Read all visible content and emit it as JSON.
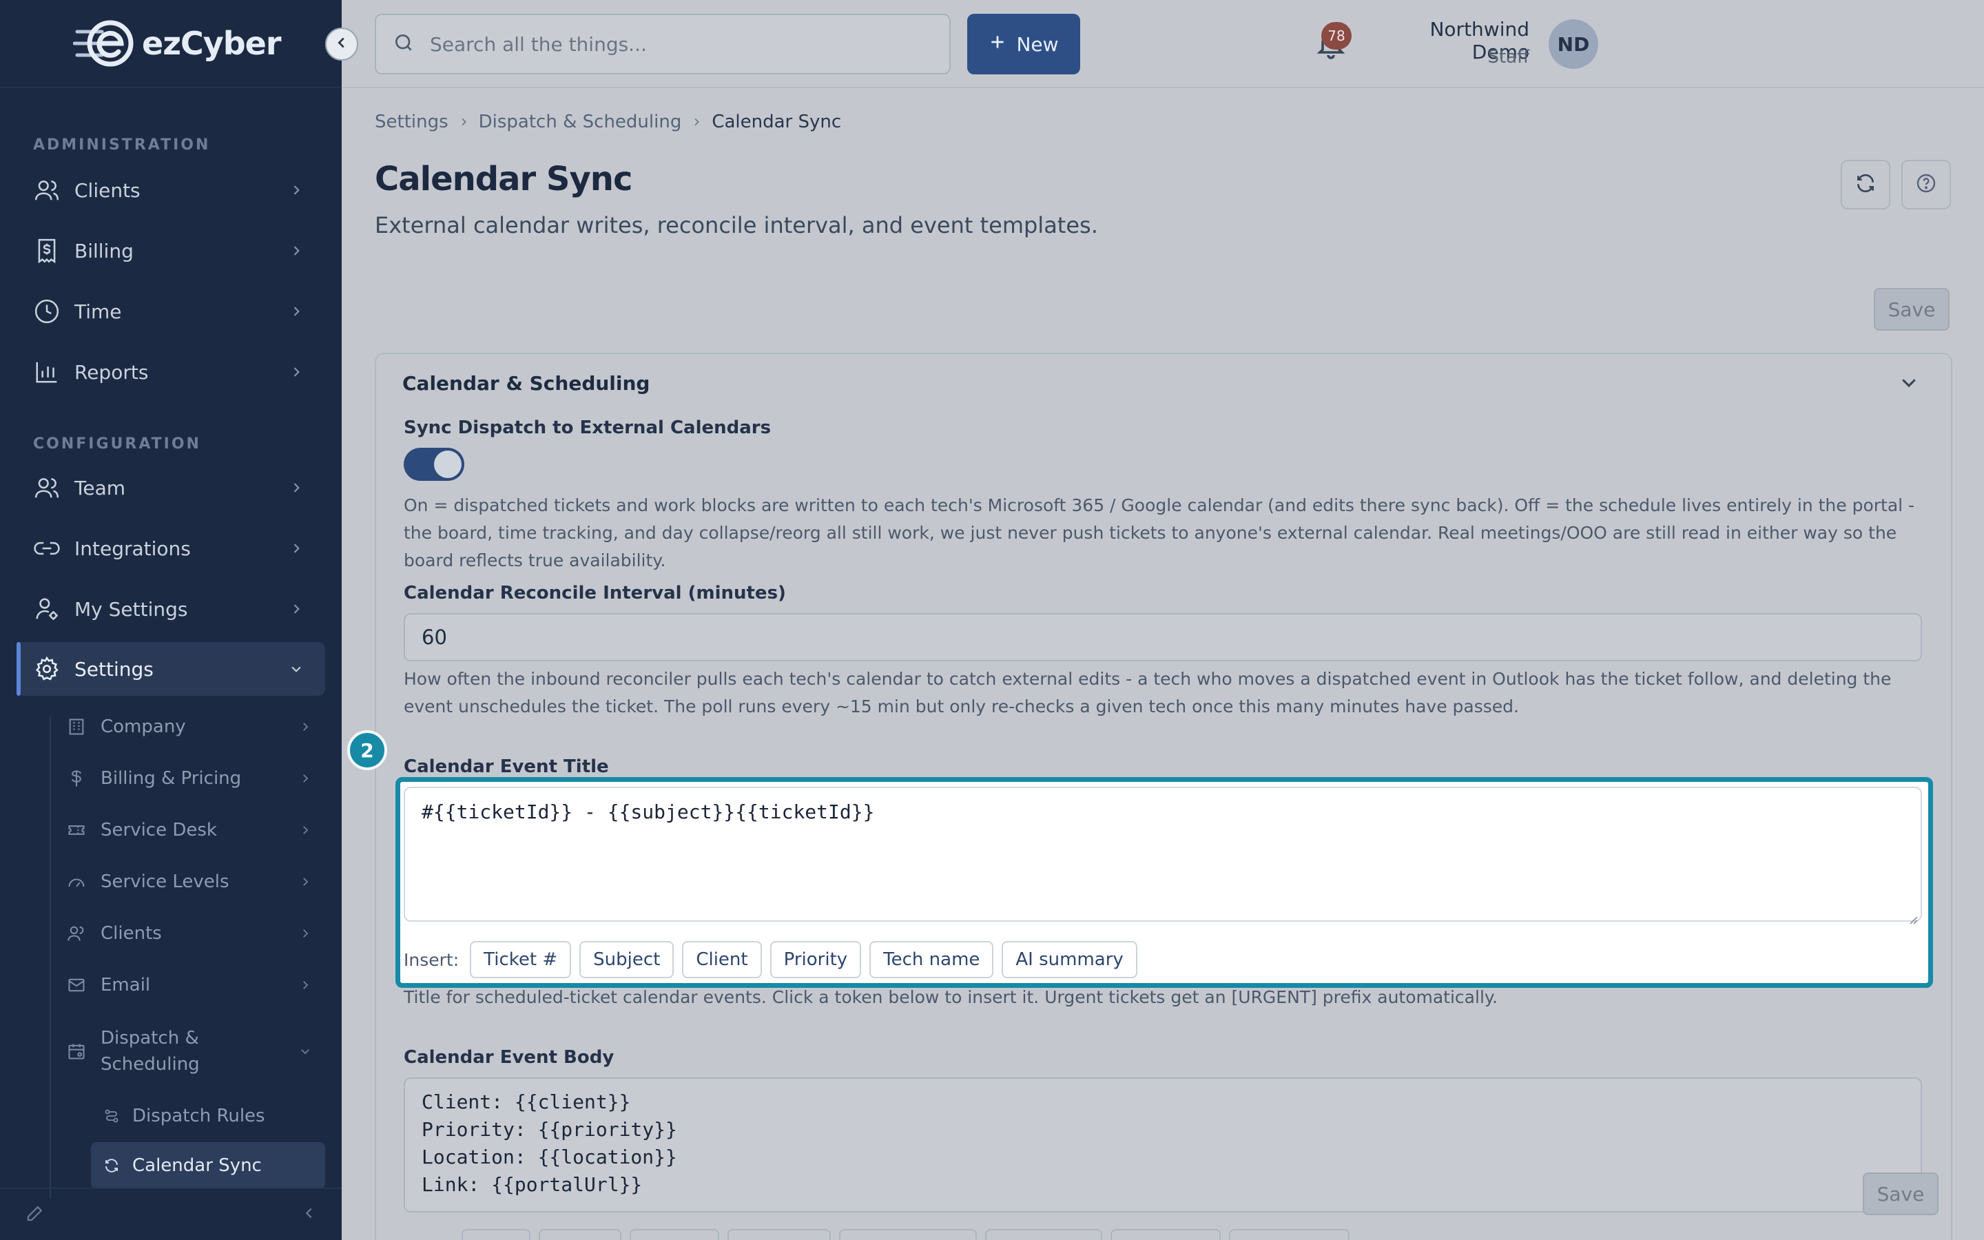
{
  "app": {
    "brand": "ezCyber"
  },
  "search": {
    "placeholder": "Search all the things..."
  },
  "topbar": {
    "new_label": "New",
    "notifications_count": "78",
    "user_name": "Northwind Demo",
    "user_role": "Staff",
    "user_initials": "ND"
  },
  "sidebar": {
    "admin_label": "ADMINISTRATION",
    "config_label": "CONFIGURATION",
    "admin_items": [
      {
        "label": "Clients",
        "icon": "users-icon"
      },
      {
        "label": "Billing",
        "icon": "billing-icon"
      },
      {
        "label": "Time",
        "icon": "clock-icon"
      },
      {
        "label": "Reports",
        "icon": "chart-icon"
      }
    ],
    "config_items": [
      {
        "label": "Team",
        "icon": "team-icon"
      },
      {
        "label": "Integrations",
        "icon": "link-icon"
      },
      {
        "label": "My Settings",
        "icon": "user-gear-icon"
      },
      {
        "label": "Settings",
        "icon": "gear-icon"
      }
    ],
    "settings_children": [
      {
        "label": "Company",
        "icon": "building-icon"
      },
      {
        "label": "Billing & Pricing",
        "icon": "dollar-icon"
      },
      {
        "label": "Service Desk",
        "icon": "ticket-icon"
      },
      {
        "label": "Service Levels",
        "icon": "gauge-icon"
      },
      {
        "label": "Clients",
        "icon": "users-icon"
      },
      {
        "label": "Email",
        "icon": "mail-icon"
      },
      {
        "label": "Dispatch & Scheduling",
        "icon": "calendar-icon"
      }
    ],
    "dispatch_children": [
      {
        "label": "Dispatch Rules",
        "icon": "route-icon"
      },
      {
        "label": "Calendar Sync",
        "icon": "sync-icon"
      }
    ]
  },
  "breadcrumb": [
    "Settings",
    "Dispatch & Scheduling",
    "Calendar Sync"
  ],
  "page": {
    "title": "Calendar Sync",
    "subtitle": "External calendar writes, reconcile interval, and event templates.",
    "save_label": "Save"
  },
  "card": {
    "title": "Calendar & Scheduling",
    "sync_label": "Sync Dispatch to External Calendars",
    "sync_enabled": true,
    "sync_help": "On = dispatched tickets and work blocks are written to each tech's Microsoft 365 / Google calendar (and edits there sync back). Off = the schedule lives entirely in the portal - the board, time tracking, and day collapse/reorg all still work, we just never push tickets to anyone's external calendar. Real meetings/OOO are still read in either way so the board reflects true availability.",
    "reconcile_label": "Calendar Reconcile Interval (minutes)",
    "reconcile_value": "60",
    "reconcile_help": "How often the inbound reconciler pulls each tech's calendar to catch external edits - a tech who moves a dispatched event in Outlook has the ticket follow, and deleting the event unschedules the ticket. The poll runs every ~15 min but only re-checks a given tech once this many minutes have passed.",
    "event_title_label": "Calendar Event Title",
    "event_title_value": "#{{ticketId}} - {{subject}}{{ticketId}}",
    "insert_label": "Insert:",
    "tokens": [
      "Ticket #",
      "Subject",
      "Client",
      "Priority",
      "Tech name",
      "AI summary"
    ],
    "event_title_help": "Title for scheduled-ticket calendar events. Click a token below to insert it. Urgent tickets get an [URGENT] prefix automatically.",
    "event_body_label": "Calendar Event Body",
    "event_body_value": "Client: {{client}}\nPriority: {{priority}}\nLocation: {{location}}\nLink: {{portalUrl}}",
    "save_label": "Save"
  },
  "annotation": {
    "step": "2"
  },
  "colors": {
    "accent": "#2e4f86",
    "highlight": "#178aa6",
    "sidebar": "#1b2942",
    "badge": "#8b4a44"
  }
}
